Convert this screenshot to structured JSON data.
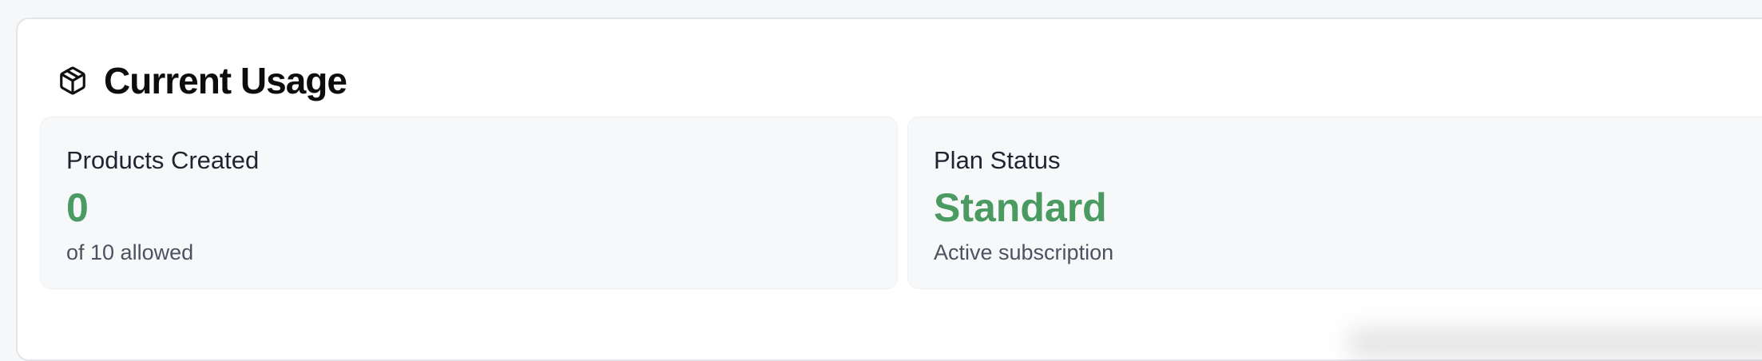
{
  "header": {
    "title": "Current Usage",
    "icon": "package-icon"
  },
  "stats": [
    {
      "label": "Products Created",
      "value": "0",
      "sub": "of 10 allowed"
    },
    {
      "label": "Plan Status",
      "value": "Standard",
      "sub": "Active subscription"
    }
  ],
  "colors": {
    "accent_green": "#4a9a62",
    "card_bg": "#ffffff",
    "stat_bg": "#f7f8fa"
  }
}
